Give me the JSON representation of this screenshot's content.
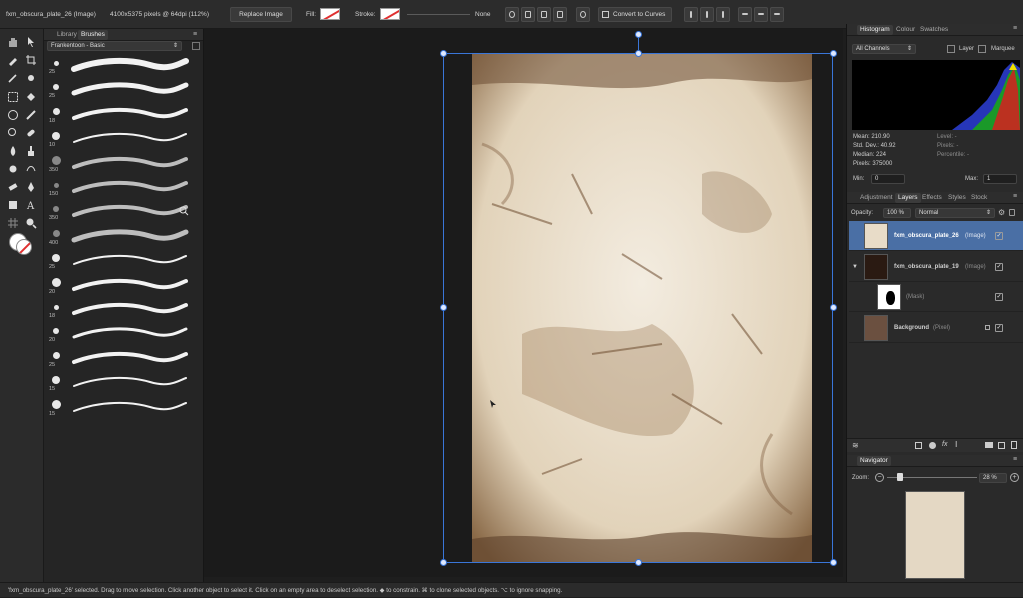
{
  "context_toolbar": {
    "doc_name": "fxm_obscura_plate_26 (Image)",
    "doc_info": "4100x5375 pixels @ 64dpi (112%)",
    "replace_image": "Replace Image",
    "fill_label": "Fill:",
    "stroke_label": "Stroke:",
    "stroke_value": "None",
    "convert_to_curves": "Convert to Curves"
  },
  "brushes_panel": {
    "tabs": [
      "Library",
      "Brushes"
    ],
    "category": "Frankentoon - Basic",
    "sizes": [
      "25",
      "25",
      "18",
      "10",
      "350",
      "150",
      "350",
      "400",
      "25",
      "20",
      "18",
      "20",
      "25",
      "15",
      "15"
    ]
  },
  "histogram_panel": {
    "tabs": [
      "Histogram",
      "Colour",
      "Swatches"
    ],
    "channel": "All Channels",
    "layer_label": "Layer",
    "marquee_label": "Marquee",
    "stats": {
      "mean": "Mean: 210.90",
      "std_dev": "Std. Dev.: 40.92",
      "median": "Median: 224",
      "pixels": "Pixels: 375000",
      "level": "Level: -",
      "pixels_sel": "Pixels: -",
      "percentile": "Percentile: -"
    },
    "min_label": "Min:",
    "min_value": "0",
    "max_label": "Max:",
    "max_value": "1"
  },
  "layers_panel": {
    "tabs": [
      "Adjustment",
      "Layers",
      "Effects",
      "Styles",
      "Stock"
    ],
    "opacity_label": "Opacity:",
    "opacity_value": "100 %",
    "blend_mode": "Normal",
    "layers": [
      {
        "name": "fxm_obscura_plate_26",
        "type": "(Image)"
      },
      {
        "name": "fxm_obscura_plate_19",
        "type": "(Image)"
      },
      {
        "name": "",
        "type": "(Mask)"
      },
      {
        "name": "Background",
        "type": "(Pixel)"
      }
    ]
  },
  "navigator_panel": {
    "tab": "Navigator",
    "zoom_label": "Zoom:",
    "zoom_value": "28 %"
  },
  "status_bar": {
    "text": "'fxm_obscura_plate_26' selected. Drag to move selection. Click another object to select it. Click on an empty area to deselect selection. ◆ to constrain. ⌘ to clone selected objects. ⌥ to ignore snapping."
  },
  "colors": {
    "accent": "#3a76d8",
    "selected_layer": "#4a6fa5",
    "canvas_bg": "#1b1b1b",
    "image_tone": "#e9ddc9"
  }
}
